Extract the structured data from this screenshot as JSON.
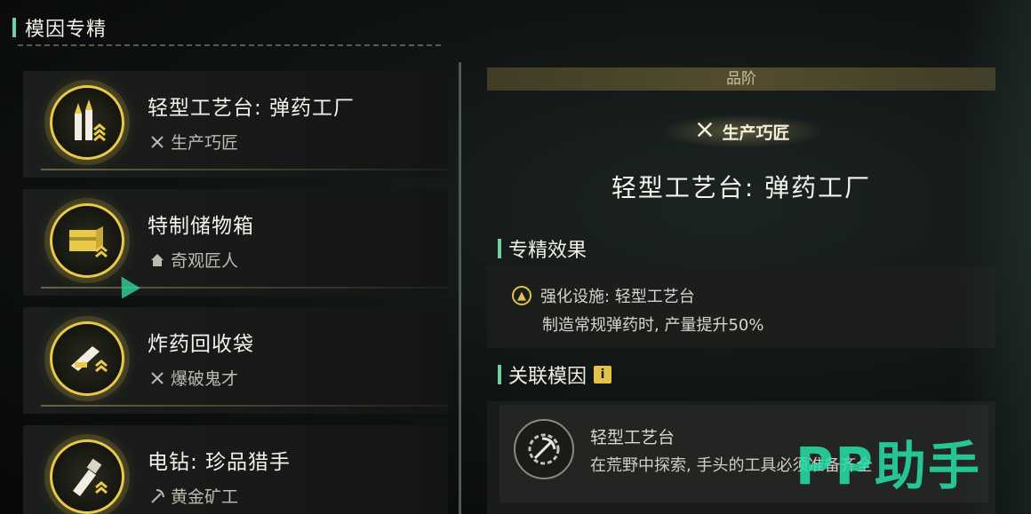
{
  "header": {
    "title": "模因专精"
  },
  "list": [
    {
      "name": "轻型工艺台: 弹药工厂",
      "tag": "生产巧匠",
      "tag_icon": "tools-icon",
      "item_icon": "ammo-icon"
    },
    {
      "name": "特制储物箱",
      "tag": "奇观匠人",
      "tag_icon": "house-icon",
      "item_icon": "crate-icon"
    },
    {
      "name": "炸药回收袋",
      "tag": "爆破鬼才",
      "tag_icon": "tools-icon",
      "item_icon": "bag-icon"
    },
    {
      "name": "电钻: 珍品猎手",
      "tag": "黄金矿工",
      "tag_icon": "pickaxe-icon",
      "item_icon": "drill-icon"
    }
  ],
  "detail": {
    "grade_label": "品阶",
    "grade_badge": "生产巧匠",
    "title": "轻型工艺台: 弹药工厂",
    "effect_section": "专精效果",
    "effect_line1": "强化设施: 轻型工艺台",
    "effect_line2": "制造常规弹药时, 产量提升50%",
    "genes_section": "关联模因",
    "gene_name": "轻型工艺台",
    "gene_desc": "在荒野中探索, 手头的工具必须准备齐全"
  },
  "watermark": "PP助手",
  "colors": {
    "accent": "#6fd0a0",
    "gold": "#e8c94a",
    "watermark": "#28e1aa"
  }
}
